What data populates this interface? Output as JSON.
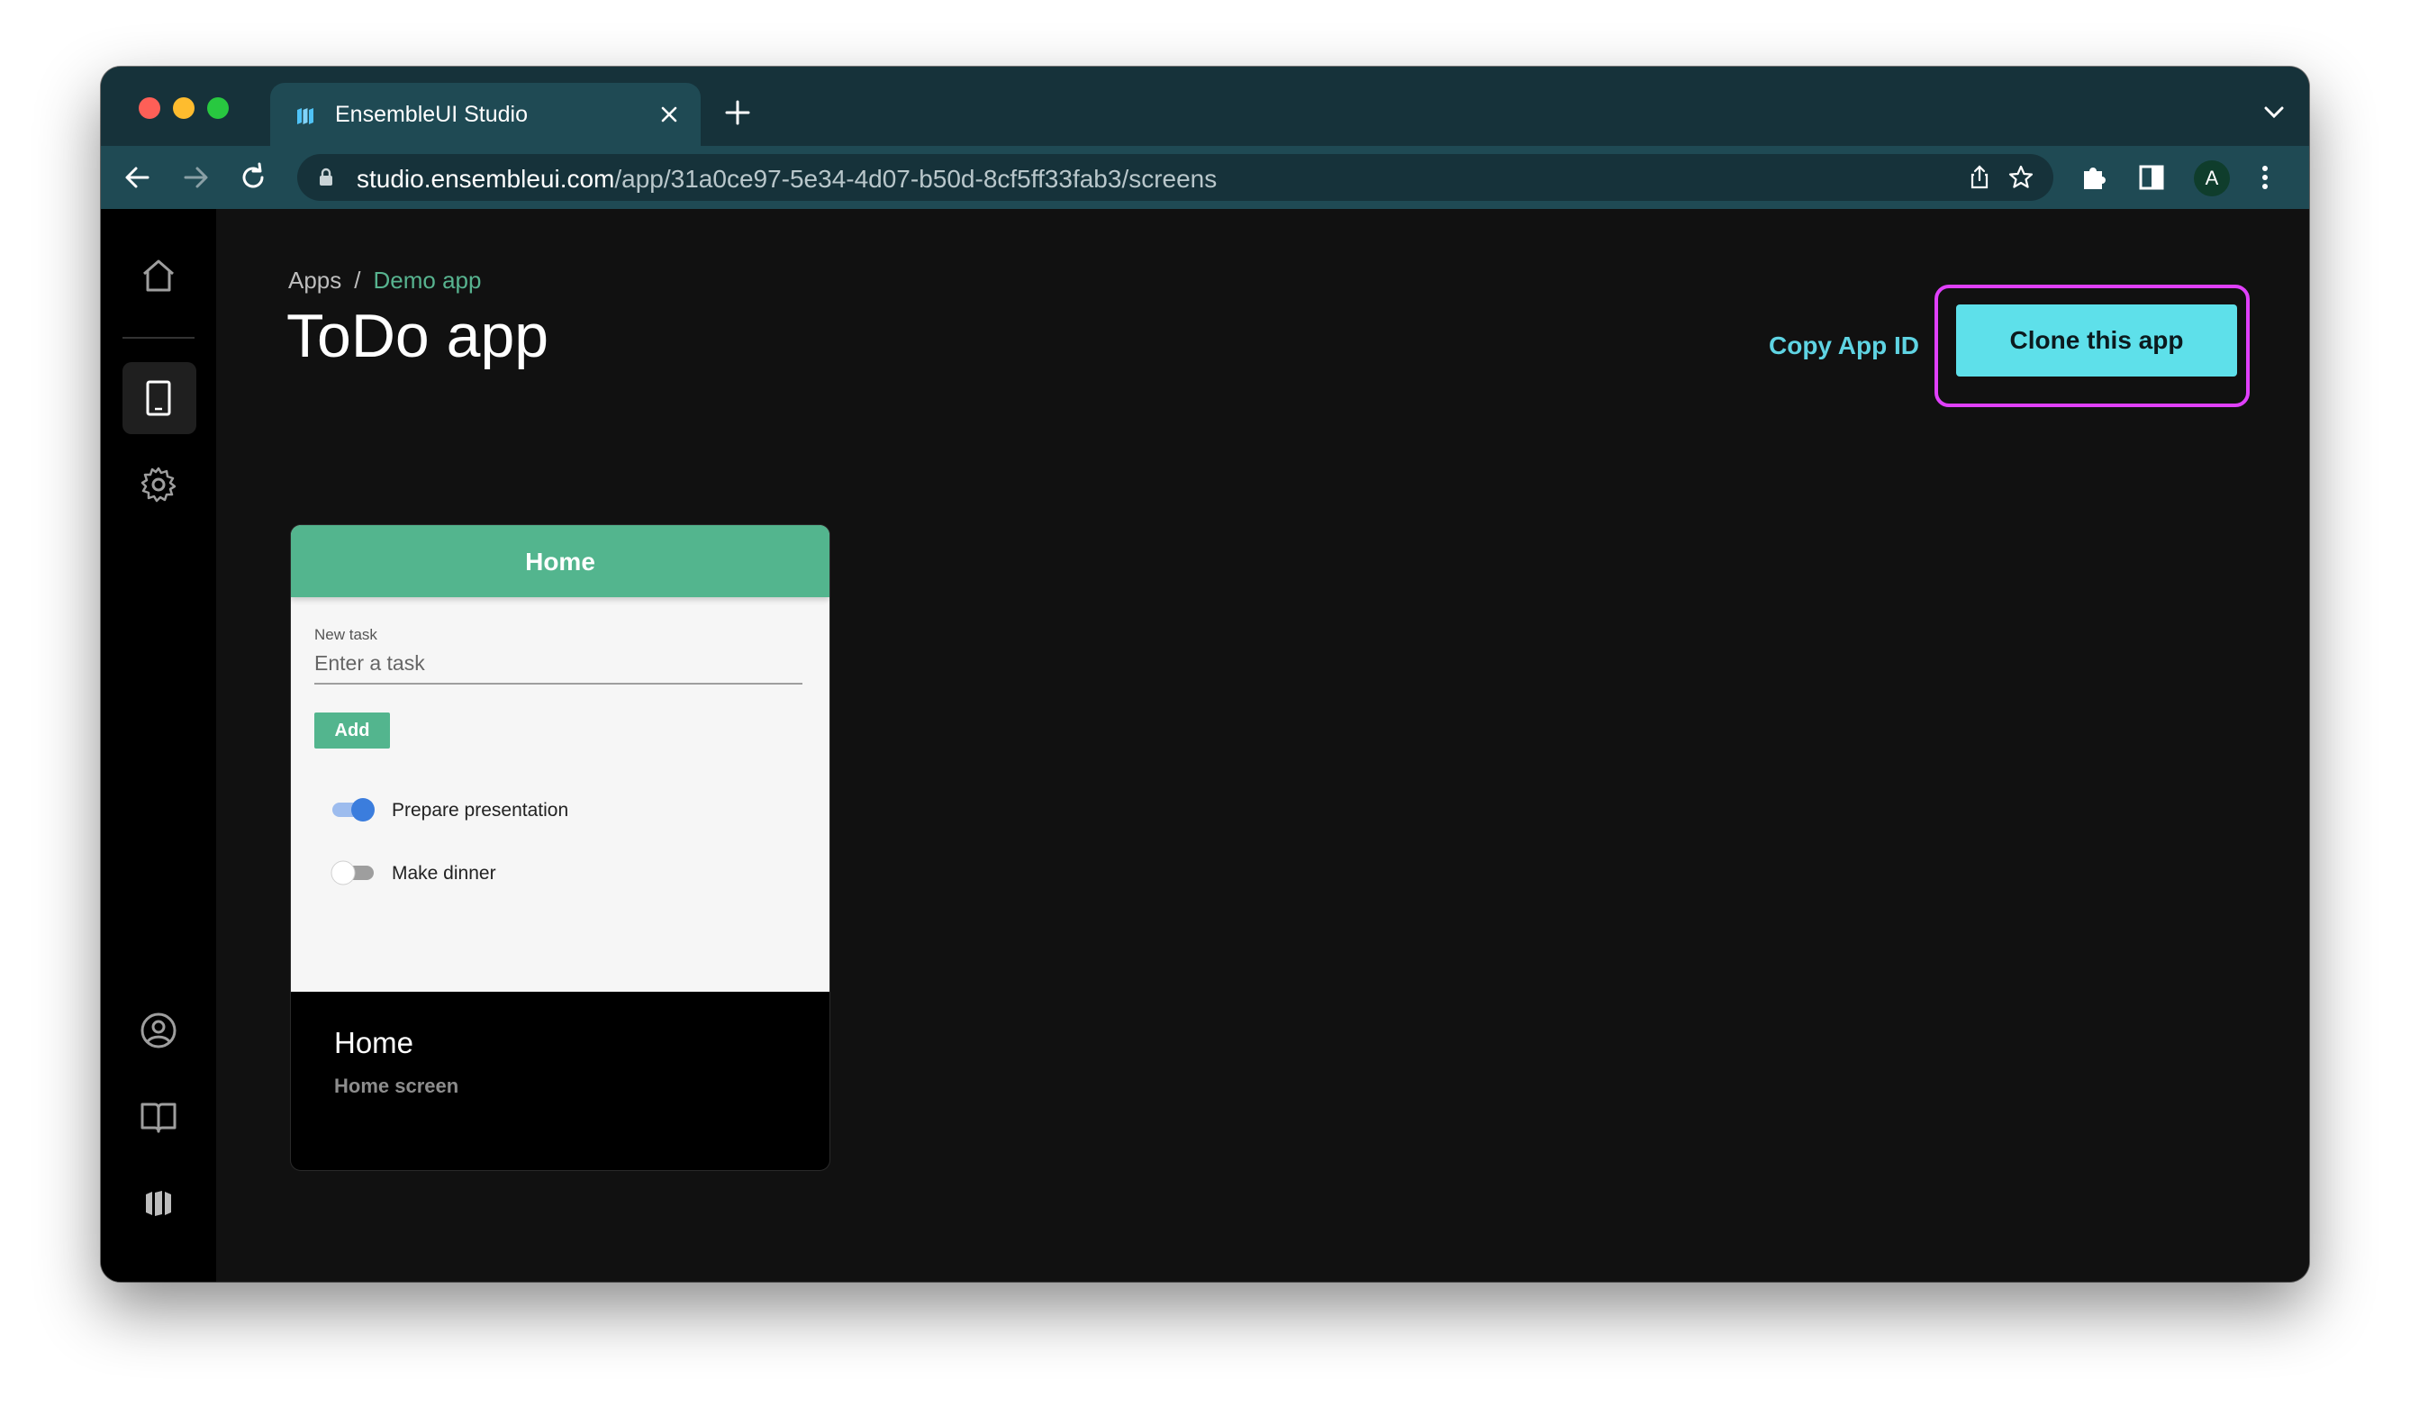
{
  "browser": {
    "tab_title": "EnsembleUI Studio",
    "url_domain": "studio.ensembleui.com",
    "url_path": "/app/31a0ce97-5e34-4d07-b50d-8cf5ff33fab3/screens",
    "profile_initial": "A"
  },
  "sidebar": {
    "items": [
      {
        "icon": "home-icon"
      },
      {
        "icon": "tablet-icon",
        "active": true
      },
      {
        "icon": "gear-icon"
      },
      {
        "icon": "user-icon"
      },
      {
        "icon": "book-icon"
      },
      {
        "icon": "ensemble-logo-icon"
      }
    ]
  },
  "header": {
    "breadcrumb_root": "Apps",
    "breadcrumb_separator": "/",
    "breadcrumb_current": "Demo app",
    "title": "ToDo app",
    "copy_id_label": "Copy App ID",
    "clone_label": "Clone this app"
  },
  "screen_card": {
    "preview": {
      "header_title": "Home",
      "field_label": "New task",
      "field_placeholder": "Enter a task",
      "add_label": "Add",
      "tasks": [
        {
          "label": "Prepare presentation",
          "done": true
        },
        {
          "label": "Make dinner",
          "done": false
        }
      ]
    },
    "name": "Home",
    "description": "Home screen"
  },
  "colors": {
    "accent_green": "#53b58e",
    "accent_cyan": "#5ee0ea",
    "highlight": "#e040fb",
    "toggle_on": "#3b7ddd"
  }
}
